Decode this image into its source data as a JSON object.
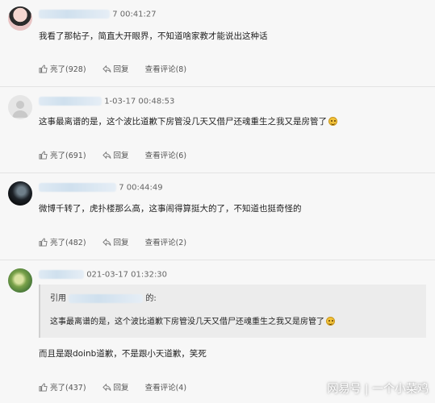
{
  "comments": [
    {
      "time": "7 00:41:27",
      "text": "我看了那帖子，简直大开眼界，不知道啥家教才能说出这种话",
      "like": "亮了(928)",
      "reply": "回复",
      "view": "查看评论(8)"
    },
    {
      "time": "1-03-17 00:48:53",
      "text": "这事最离谱的是，这个波比道歉下房管没几天又借尸还魂重生之我又是房管了",
      "like": "亮了(691)",
      "reply": "回复",
      "view": "查看评论(6)"
    },
    {
      "time": "7 00:44:49",
      "text": "微博千转了，虎扑楼那么高，这事闹得算挺大的了，不知道也挺奇怪的",
      "like": "亮了(482)",
      "reply": "回复",
      "view": "查看评论(2)"
    },
    {
      "time": "021-03-17 01:32:30",
      "quote_prefix": "引用",
      "quote_suffix": "的:",
      "quote_text": "这事最离谱的是，这个波比道歉下房管没几天又借尸还魂重生之我又是房管了",
      "text": "而且是跟doinb道歉，不是跟小天道歉，笑死",
      "like": "亮了(437)",
      "reply": "回复",
      "view": "查看评论(4)"
    }
  ],
  "watermark": "网易号 | 一个小菜鸡",
  "icons": {
    "like": "thumbs-up-icon",
    "reply": "reply-arrow-icon",
    "emoji": "grin-emoji-icon"
  }
}
